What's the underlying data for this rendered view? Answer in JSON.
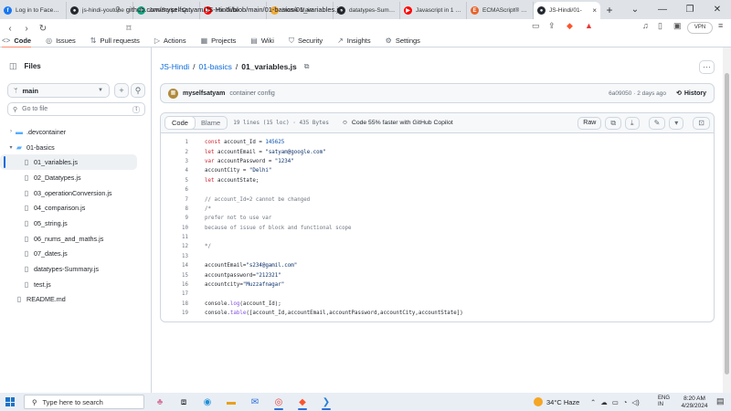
{
  "browser": {
    "tabs": [
      {
        "label": "Log in to Facebook",
        "icon": "facebook-icon",
        "color": "#1877f2",
        "glyph": "f"
      },
      {
        "label": "js-hindi-youtube",
        "icon": "github-icon",
        "color": "#24292f",
        "glyph": "●"
      },
      {
        "label": "JavaScript - Quick",
        "icon": "chatgpt-icon",
        "color": "#10a37f",
        "glyph": "✦"
      },
      {
        "label": "YouTube",
        "icon": "youtube-icon",
        "color": "#ff0000",
        "glyph": "▶"
      },
      {
        "label": "Home Main",
        "icon": "home-icon",
        "color": "#f0a830",
        "glyph": "⌂"
      },
      {
        "label": "datatypes-Summa",
        "icon": "github-icon",
        "color": "#24292f",
        "glyph": "●"
      },
      {
        "label": "Javascript in 1 sho",
        "icon": "youtube-icon",
        "color": "#ff0000",
        "glyph": "▶"
      },
      {
        "label": "ECMAScript® 202",
        "icon": "ecma-icon",
        "color": "#e8632b",
        "glyph": "E"
      },
      {
        "label": "JS-Hindi/01-",
        "icon": "github-icon",
        "color": "#24292f",
        "glyph": "●",
        "active": true
      }
    ],
    "new_tab": "+",
    "url": "github.com/myselfsatyam/JS-Hindi/blob/main/01-basics/01_variables.js",
    "vpn_label": "VPN"
  },
  "repo_nav": [
    {
      "label": "Code",
      "icon": "code-icon",
      "glyph": "<>",
      "active": true
    },
    {
      "label": "Issues",
      "icon": "issues-icon",
      "glyph": "◎"
    },
    {
      "label": "Pull requests",
      "icon": "pull-request-icon",
      "glyph": "⇅"
    },
    {
      "label": "Actions",
      "icon": "actions-icon",
      "glyph": "▷"
    },
    {
      "label": "Projects",
      "icon": "projects-icon",
      "glyph": "▦"
    },
    {
      "label": "Wiki",
      "icon": "wiki-icon",
      "glyph": "▤"
    },
    {
      "label": "Security",
      "icon": "shield-icon",
      "glyph": "⛉"
    },
    {
      "label": "Insights",
      "icon": "insights-icon",
      "glyph": "↗"
    },
    {
      "label": "Settings",
      "icon": "gear-icon",
      "glyph": "⚙"
    }
  ],
  "sidebar": {
    "title": "Files",
    "branch": "main",
    "goto_placeholder": "Go to file",
    "goto_key": "t",
    "tree": [
      {
        "label": ".devcontainer",
        "type": "folder",
        "open": false,
        "depth": 0
      },
      {
        "label": "01-basics",
        "type": "folder",
        "open": true,
        "depth": 0
      },
      {
        "label": "01_variables.js",
        "type": "file",
        "depth": 1,
        "selected": true
      },
      {
        "label": "02_Datatypes.js",
        "type": "file",
        "depth": 1
      },
      {
        "label": "03_operationConversion.js",
        "type": "file",
        "depth": 1
      },
      {
        "label": "04_comparison.js",
        "type": "file",
        "depth": 1
      },
      {
        "label": "05_string.js",
        "type": "file",
        "depth": 1
      },
      {
        "label": "06_nums_and_maths.js",
        "type": "file",
        "depth": 1
      },
      {
        "label": "07_dates.js",
        "type": "file",
        "depth": 1
      },
      {
        "label": "datatypes-Summary.js",
        "type": "file",
        "depth": 1
      },
      {
        "label": "test.js",
        "type": "file",
        "depth": 1
      },
      {
        "label": "README.md",
        "type": "file",
        "depth": 0
      }
    ]
  },
  "breadcrumb": {
    "repo": "JS-Hindi",
    "sep": "/",
    "folder": "01-basics",
    "file": "01_variables.js"
  },
  "commit": {
    "user": "myselfsatyam",
    "message": "container config",
    "hash_time": "6a09050 · 2 days ago",
    "history_label": "History"
  },
  "file": {
    "tab_code": "Code",
    "tab_blame": "Blame",
    "info": "19 lines (15 loc) · 435 Bytes",
    "copilot": "Code 55% faster with GitHub Copilot",
    "raw_label": "Raw",
    "lines": [
      {
        "n": "1",
        "html": "<span class='kw'>const</span> account_Id = <span class='num'>145625</span>"
      },
      {
        "n": "2",
        "html": "<span class='kw'>let</span> accountEmail = <span class='str'>\"satyam@google.com\"</span>"
      },
      {
        "n": "3",
        "html": "<span class='kw'>var</span> accountPassword = <span class='str'>\"1234\"</span>"
      },
      {
        "n": "4",
        "html": "accountCity = <span class='str'>\"Delhi\"</span>"
      },
      {
        "n": "5",
        "html": "<span class='kw'>let</span> accountState;"
      },
      {
        "n": "6",
        "html": ""
      },
      {
        "n": "7",
        "html": "<span class='cm'>// account_Id=2 cannot be changed</span>"
      },
      {
        "n": "8",
        "html": "<span class='cm'>/*</span>"
      },
      {
        "n": "9",
        "html": "<span class='cm'>prefer not to use var</span>"
      },
      {
        "n": "10",
        "html": "<span class='cm'>because of issue of block and functional scope</span>"
      },
      {
        "n": "11",
        "html": ""
      },
      {
        "n": "12",
        "html": "<span class='cm'>*/</span>"
      },
      {
        "n": "13",
        "html": ""
      },
      {
        "n": "14",
        "html": "accountEmail=<span class='str'>\"s234@gamil.com\"</span>"
      },
      {
        "n": "15",
        "html": "accountpassword=<span class='str'>\"212321\"</span>"
      },
      {
        "n": "16",
        "html": "accountcity=<span class='str'>\"Muzzafnagar\"</span>"
      },
      {
        "n": "17",
        "html": ""
      },
      {
        "n": "18",
        "html": "console.<span class='fn'>log</span>(account_Id);"
      },
      {
        "n": "19",
        "html": "console.<span class='fn'>table</span>([account_Id,accountEmail,accountPassword,accountCity,accountState])"
      }
    ]
  },
  "taskbar": {
    "search_placeholder": "Type here to search",
    "weather": "34°C  Haze",
    "lang_1": "ENG",
    "lang_2": "IN",
    "time": "8:20 AM",
    "date": "4/29/2024"
  },
  "colors": {
    "link": "#0969da",
    "accent_tab": "#fd8c73",
    "selected_marker": "#0969da"
  }
}
